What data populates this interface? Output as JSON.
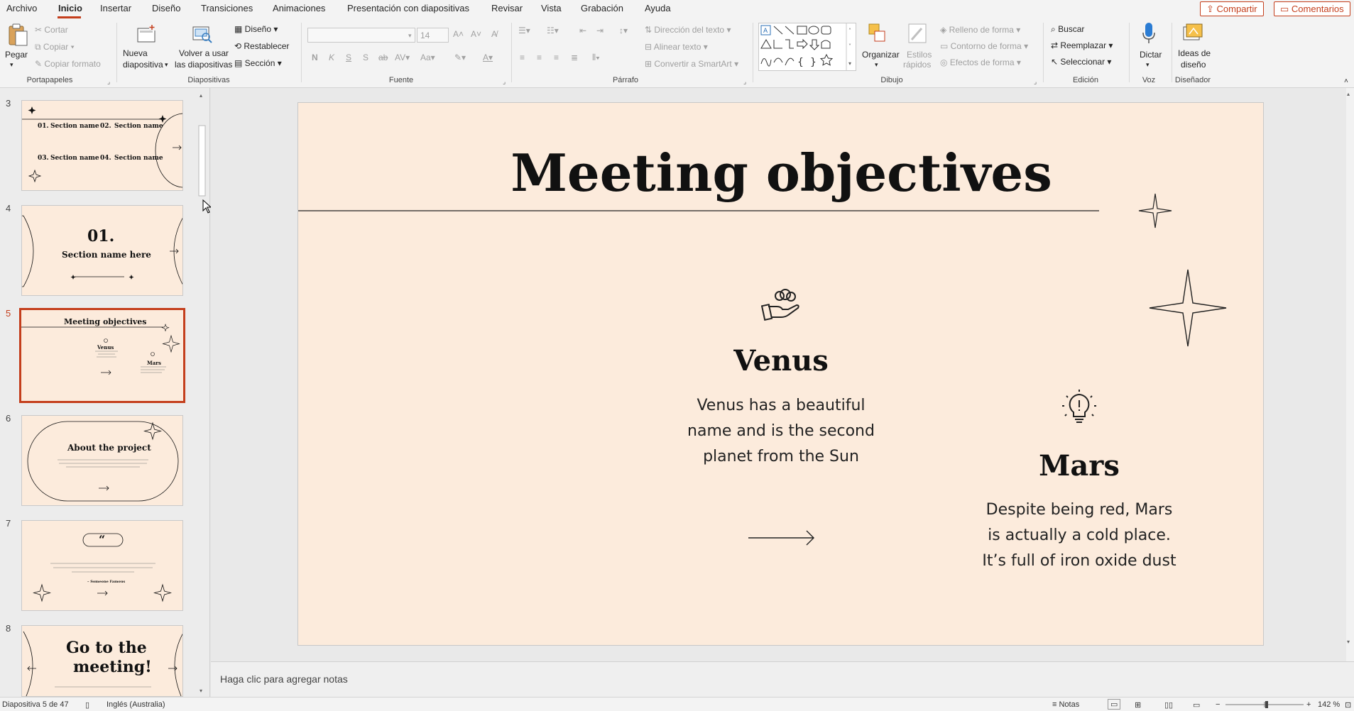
{
  "menu": {
    "tabs": [
      "Archivo",
      "Inicio",
      "Insertar",
      "Diseño",
      "Transiciones",
      "Animaciones",
      "Presentación con diapositivas",
      "Revisar",
      "Vista",
      "Grabación",
      "Ayuda"
    ],
    "share_label": "Compartir",
    "comments_label": "Comentarios"
  },
  "ribbon": {
    "clipboard": {
      "paste": "Pegar",
      "cut": "Cortar",
      "copy": "Copiar",
      "format_painter": "Copiar formato",
      "label": "Portapapeles"
    },
    "slides": {
      "new_slide_l1": "Nueva",
      "new_slide_l2": "diapositiva",
      "reuse_l1": "Volver a usar",
      "reuse_l2": "las diapositivas",
      "layout": "Diseño",
      "reset": "Restablecer",
      "section": "Sección",
      "label": "Diapositivas"
    },
    "font": {
      "size": "14",
      "label": "Fuente"
    },
    "paragraph": {
      "text_direction": "Dirección del texto",
      "align_text": "Alinear texto",
      "smartart": "Convertir a SmartArt",
      "label": "Párrafo"
    },
    "drawing": {
      "arrange": "Organizar",
      "quick_styles_l1": "Estilos",
      "quick_styles_l2": "rápidos",
      "fill": "Relleno de forma",
      "outline": "Contorno de forma",
      "effects": "Efectos de forma",
      "label": "Dibujo"
    },
    "editing": {
      "find": "Buscar",
      "replace": "Reemplazar",
      "select": "Seleccionar",
      "label": "Edición"
    },
    "voice": {
      "dictate": "Dictar",
      "label": "Voz"
    },
    "designer": {
      "ideas_l1": "Ideas de",
      "ideas_l2": "diseño",
      "label": "Diseñador"
    }
  },
  "thumbnails": {
    "numbers": [
      "3",
      "4",
      "5",
      "6",
      "7",
      "8"
    ],
    "t3": {
      "n1": "01.",
      "s1": "Section name",
      "n2": "02.",
      "s2": "Section name",
      "n3": "03.",
      "s3": "Section name",
      "n4": "04.",
      "s4": "Section name"
    },
    "t4": {
      "num": "01.",
      "title": "Section name here"
    },
    "t5": {
      "title": "Meeting objectives",
      "venus": "Venus",
      "mars": "Mars"
    },
    "t6": {
      "title": "About the project"
    },
    "t7": {
      "quote_mark": "“",
      "attrib": "– Someone Famous"
    },
    "t8": {
      "title_l1": "Go to the",
      "title_l2": "meeting!"
    }
  },
  "slide": {
    "title": "Meeting objectives",
    "venus_title": "Venus",
    "venus_l1": "Venus has a beautiful",
    "venus_l2": "name and is the second",
    "venus_l3": "planet from the Sun",
    "mars_title": "Mars",
    "mars_l1": "Despite being red, Mars",
    "mars_l2": "is actually a cold place.",
    "mars_l3": "It’s full of iron oxide dust"
  },
  "notes": {
    "placeholder": "Haga clic para agregar notas"
  },
  "status": {
    "slide_count": "Diapositiva 5 de 47",
    "language": "Inglés (Australia)",
    "notes": "Notas",
    "zoom": "142 %"
  },
  "colors": {
    "accent": "#c43e1c",
    "slide_bg": "#fcebdc"
  }
}
